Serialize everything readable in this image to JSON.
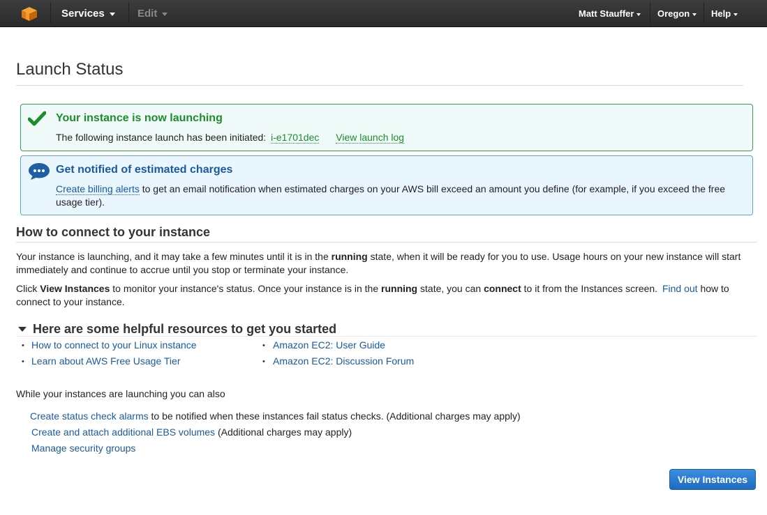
{
  "topbar": {
    "services": "Services",
    "edit": "Edit",
    "user": "Matt Stauffer",
    "region": "Oregon",
    "help": "Help",
    "logo_icon": "aws-cube-icon",
    "logo_color": "#f08a1d"
  },
  "page": {
    "title": "Launch Status"
  },
  "success_panel": {
    "icon": "checkmark-icon",
    "title": "Your instance is now launching",
    "text_prefix": "The following instance launch has been initiated:",
    "instance_id": "i-e1701dec",
    "log_link": "View launch log",
    "color": "#1c8c2c"
  },
  "info_panel": {
    "icon": "speech-bubble-icon",
    "title": "Get notified of estimated charges",
    "link": "Create billing alerts",
    "text": "to get an email notification when estimated charges on your AWS bill exceed an amount you define (for example, if you exceed the free usage tier).",
    "color": "#1a5aa0"
  },
  "connect": {
    "heading": "How to connect to your instance",
    "p1_a": "Your instance is launching, and it may take a few minutes until it is in the",
    "p1_bold": "running",
    "p1_b": "state, when it will be ready for you to use. Usage hours on your new instance will start immediately and continue to accrue until you stop or terminate your instance.",
    "p2_a": "Click",
    "p2_bold1": "View Instances",
    "p2_b": "to monitor your instance's status. Once your instance is in the",
    "p2_bold2": "running",
    "p2_c": "state, you can",
    "p2_bold3": "connect",
    "p2_d": "to it from the Instances screen.",
    "p2_link": "Find out",
    "p2_e": "how to connect to your instance."
  },
  "resources": {
    "heading": "Here are some helpful resources to get you started",
    "links": [
      "How to connect to your Linux instance",
      "Learn about AWS Free Usage Tier",
      "Amazon EC2: User Guide",
      "Amazon EC2: Discussion Forum"
    ]
  },
  "also": {
    "heading": "While your instances are launching you can also",
    "items": [
      {
        "link": "Create status check alarms",
        "text": "to be notified when these instances fail status checks. (Additional charges may apply)"
      },
      {
        "link": "Create and attach additional EBS volumes",
        "text": "(Additional charges may apply)"
      },
      {
        "link": "Manage security groups",
        "text": ""
      }
    ]
  },
  "button": {
    "label": "View Instances",
    "color": "#1d6bc2"
  }
}
